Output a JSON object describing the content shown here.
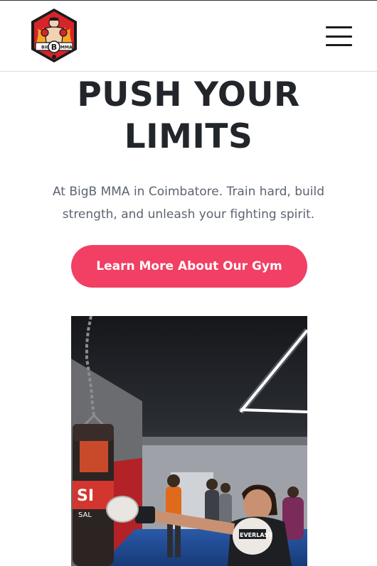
{
  "header": {
    "logo": {
      "icon": "bigb-mma-logo",
      "text_left": "BIG",
      "text_center": "B",
      "text_right": "MMA"
    },
    "menu_icon": "hamburger-menu-icon"
  },
  "hero": {
    "title_line1": "PUSH YOUR",
    "title_line2": "LIMITS",
    "subtitle_line1": "At BigB MMA in Coimbatore. Train hard, build",
    "subtitle_line2": "strength, and unleash your fighting spirit.",
    "cta_label": "Learn More About Our Gym"
  },
  "photo": {
    "bag_text": "SI",
    "bag_subtext": "SAL",
    "glove_text": "EVERLAST"
  },
  "colors": {
    "accent": "#f23f64",
    "title": "#22262b",
    "subtitle": "#5c6470",
    "logo_red": "#d7242a"
  }
}
